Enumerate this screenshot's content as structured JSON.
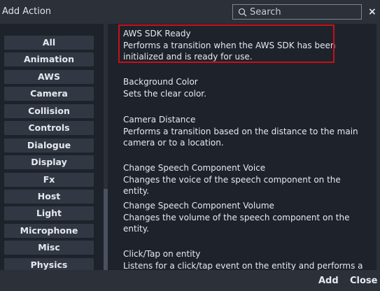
{
  "window": {
    "title": "Add Action",
    "close_glyph": "×"
  },
  "search": {
    "placeholder": "Search",
    "value": ""
  },
  "categories": [
    "All",
    "Animation",
    "AWS",
    "Camera",
    "Collision",
    "Controls",
    "Dialogue",
    "Display",
    "Fx",
    "Host",
    "Light",
    "Microphone",
    "Misc",
    "Physics"
  ],
  "actions": [
    {
      "name": "AWS SDK Ready",
      "desc1": "Performs a transition when the AWS SDK has been",
      "desc2": "initialized and is ready for use.",
      "selected": true
    },
    {
      "name": "Background Color",
      "desc1": "Sets the clear color.",
      "desc2": ""
    },
    {
      "name": "Camera Distance",
      "desc1": "Performs a transition based on the distance to the main",
      "desc2": "camera or to a location."
    },
    {
      "name": "Change Speech Component Voice",
      "desc1": "Changes the voice of the speech component on the entity.",
      "desc2": ""
    },
    {
      "name": "Change Speech Component Volume",
      "desc1": "Changes the volume of the speech component on the",
      "desc2": "entity."
    },
    {
      "name": "Click/Tap on entity",
      "desc1": "Listens for a click/tap event on the entity and performs a",
      "desc2": ""
    }
  ],
  "footer": {
    "add_label": "Add",
    "close_label": "Close"
  },
  "colors": {
    "highlight": "#c8101b",
    "panel": "#1e222a",
    "button": "#323843"
  }
}
